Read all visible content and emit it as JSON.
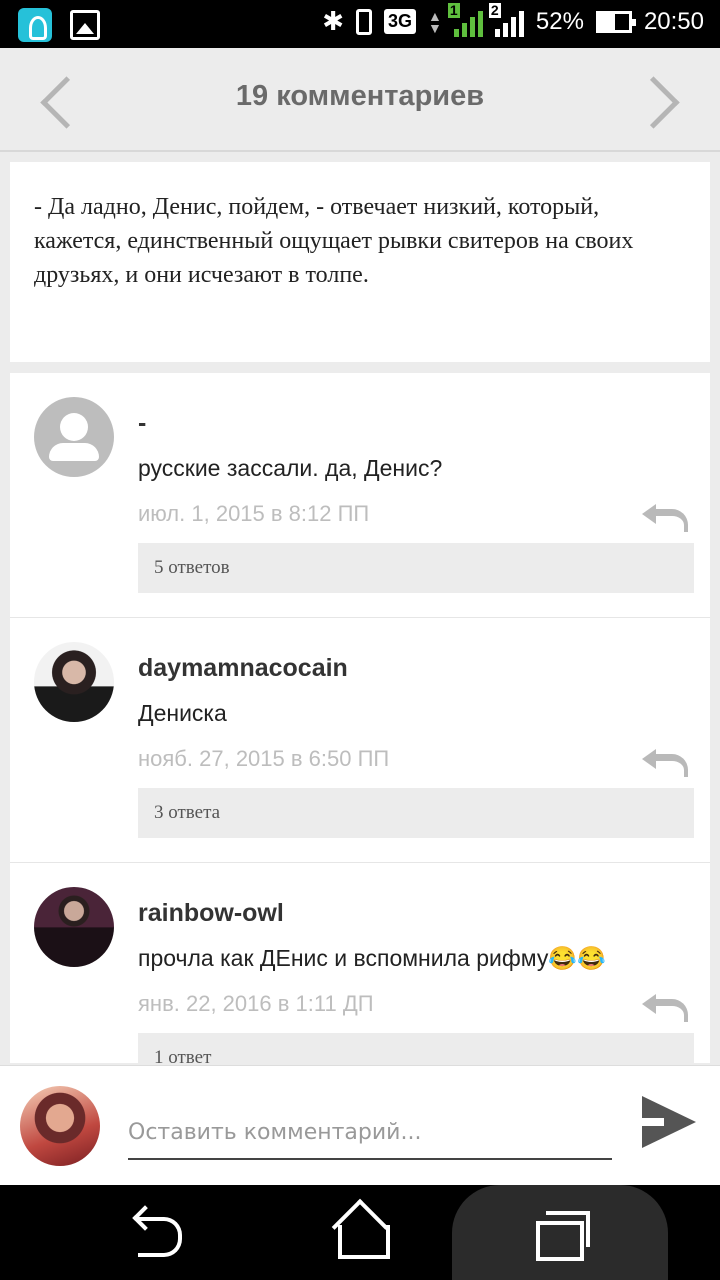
{
  "status_bar": {
    "network": "3G",
    "sim1_badge": "1",
    "sim2_badge": "2",
    "battery": "52%",
    "time": "20:50"
  },
  "header": {
    "title": "19 комментариев",
    "prev_icon": "chevron-left-icon",
    "next_icon": "chevron-right-icon"
  },
  "quote": {
    "text": "- Да ладно, Денис, пойдем, - отвечает низкий, который, кажется, единственный ощущает рывки свитеров на своих друзьях, и они исчезают в толпе."
  },
  "comments": [
    {
      "author": "-",
      "text": "русские зассали. да, Денис?",
      "date": "июл. 1, 2015 в 8:12 ПП",
      "replies": "5 ответов"
    },
    {
      "author": "daymamnacocain",
      "text": "Дениска",
      "date": "нояб. 27, 2015 в 6:50 ПП",
      "replies": "3 ответа"
    },
    {
      "author": "rainbow-owl",
      "text": "прочла как ДЕнис и вспомнила рифму😂😂",
      "date": "янв. 22, 2016 в 1:11 ДП",
      "replies": "1 ответ"
    }
  ],
  "compose": {
    "placeholder": "Оставить комментарий...",
    "send_icon": "send-icon"
  }
}
